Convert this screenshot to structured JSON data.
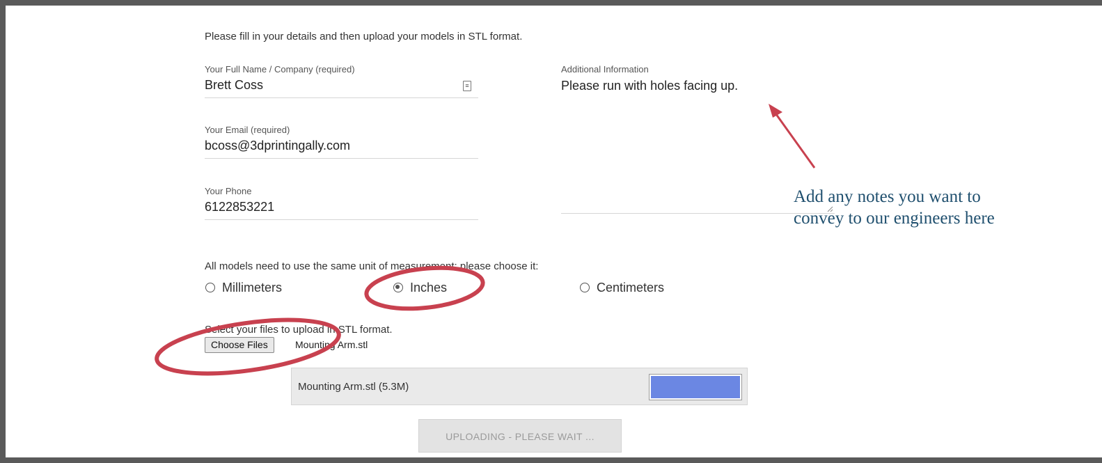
{
  "form": {
    "intro": "Please fill in your details and then upload your models in STL format.",
    "name": {
      "label": "Your Full Name / Company (required)",
      "value": "Brett Coss"
    },
    "email": {
      "label": "Your Email (required)",
      "value": "bcoss@3dprintingally.com"
    },
    "phone": {
      "label": "Your Phone",
      "value": "6122853221"
    },
    "additional": {
      "label": "Additional Information",
      "value": "Please run with holes facing up."
    },
    "units": {
      "prompt": "All models need to use the same unit of measurement; please choose it:",
      "options": [
        {
          "label": "Millimeters",
          "checked": false
        },
        {
          "label": "Inches",
          "checked": true
        },
        {
          "label": "Centimeters",
          "checked": false
        }
      ]
    },
    "files": {
      "prompt": "Select your files to upload in STL format.",
      "choose_label": "Choose Files",
      "chosen": "Mounting Arm.stl"
    },
    "upload": {
      "file_label": "Mounting Arm.stl (5.3M)",
      "progress": 1.0,
      "progress_color": "#6b87e3",
      "button_label": "UPLOADING - PLEASE WAIT ..."
    }
  },
  "annotation": {
    "line1": "Add any notes you want to",
    "line2": "convey to our engineers here",
    "color": "#1f4f6e",
    "markup_color": "#c8414f"
  },
  "icons": {
    "contact": "contact-card-icon"
  }
}
